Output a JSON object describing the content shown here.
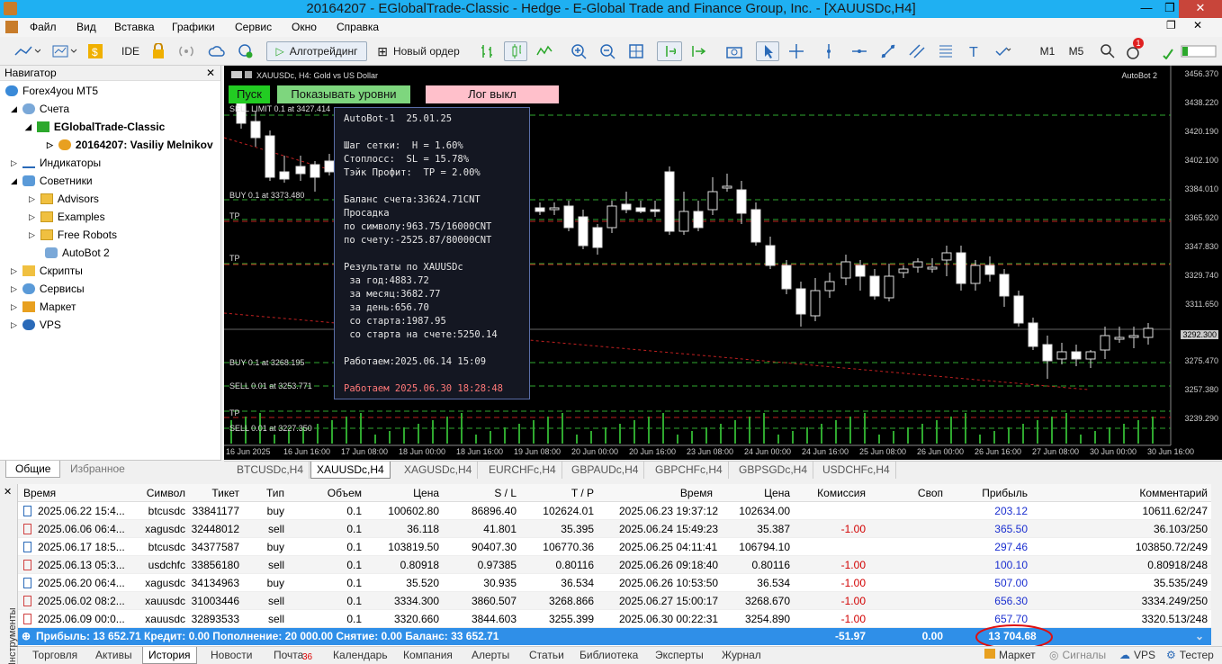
{
  "window": {
    "title": "20164207 - EGlobalTrade-Classic - Hedge - E-Global Trade and Finance Group, Inc. - [XAUUSDc,H4]"
  },
  "menu": [
    "Файл",
    "Вид",
    "Вставка",
    "Графики",
    "Сервис",
    "Окно",
    "Справка"
  ],
  "toolbar": {
    "ide": "IDE",
    "algo": "Алготрейдинг",
    "new_order": "Новый ордер",
    "m1": "M1",
    "m5": "M5",
    "notif_count": "1"
  },
  "navigator": {
    "title": "Навигатор",
    "items": [
      "Forex4you MT5",
      "Счета",
      "EGlobalTrade-Classic",
      "20164207: Vasiliy Melnikov",
      "Индикаторы",
      "Советники",
      "Advisors",
      "Examples",
      "Free Robots",
      "AutoBot 2",
      "Скрипты",
      "Сервисы",
      "Маркет",
      "VPS"
    ],
    "tabs": [
      "Общие",
      "Избранное"
    ]
  },
  "chart": {
    "symbol_label": "XAUUSDc, H4:  Gold vs US Dollar",
    "ea_label": "AutoBot 2",
    "btn_start": "Пуск",
    "btn_levels": "Показывать уровни",
    "btn_log": "Лог выкл",
    "colors": {
      "start": "#22cc22",
      "levels": "#7ed67e",
      "log": "#ffc0cb"
    },
    "order_labels": [
      "SELL LIMIT 0.1 at 3427.414",
      "BUY 0.1 at 3373.480",
      "TP",
      "TP",
      "BUY 0.1 at 3268.195",
      "SELL 0.01 at 3253.771",
      "TP",
      "SELL 0.01 at 3227.350"
    ],
    "current_price": "3292.300",
    "price_ticks": [
      "3456.370",
      "3438.220",
      "3420.190",
      "3402.100",
      "3384.010",
      "3365.920",
      "3347.830",
      "3329.740",
      "3311.650",
      "3292.300",
      "3275.470",
      "3257.380",
      "3239.290"
    ],
    "time_ticks": [
      "16 Jun 2025",
      "16 Jun 16:00",
      "17 Jun 08:00",
      "18 Jun 00:00",
      "18 Jun 16:00",
      "19 Jun 08:00",
      "20 Jun 00:00",
      "20 Jun 16:00",
      "23 Jun 08:00",
      "24 Jun 00:00",
      "24 Jun 16:00",
      "25 Jun 08:00",
      "26 Jun 00:00",
      "26 Jun 16:00",
      "27 Jun 08:00",
      "30 Jun 00:00",
      "30 Jun 16:00"
    ],
    "info": {
      "l1": "AutoBot-1  25.01.25",
      "l2": "Шаг сетки:  H = 1.60%",
      "l3": "Стоплосс:  SL = 15.78%",
      "l4": "Тэйк Профит:  TP = 2.00%",
      "l5": "Баланс счета:33624.71CNT",
      "l6": "Просадка",
      "l7": "по символу:963.75/16000CNT",
      "l8": "по счету:-2525.87/80000CNT",
      "l9": "Результаты по XAUUSDc",
      "l10": " за год:4883.72",
      "l11": " за месяц:3682.77",
      "l12": " за день:656.70",
      "l13": " со старта:1987.95",
      "l14": " со старта на счете:5250.14",
      "l15": "Работаем:2025.06.14 15:09",
      "l16": "Работаем 2025.06.30 18:28:48"
    }
  },
  "chart_tabs": [
    "BTCUSDc,H4",
    "XAUUSDc,H4",
    "XAGUSDc,H4",
    "EURCHFc,H4",
    "GBPAUDc,H4",
    "GBPCHFc,H4",
    "GBPSGDc,H4",
    "USDCHFc,H4"
  ],
  "terminal": {
    "side_label": "Инструменты",
    "headers": [
      "Время",
      "Символ",
      "Тикет",
      "Тип",
      "Объем",
      "Цена",
      "S / L",
      "T / P",
      "Время",
      "Цена",
      "Комиссия",
      "Своп",
      "Прибыль",
      "Комментарий"
    ],
    "rows": [
      [
        "2025.06.22 15:4...",
        "btcusdc",
        "33841177",
        "buy",
        "0.1",
        "100602.80",
        "86896.40",
        "102624.01",
        "2025.06.23 19:37:12",
        "102634.00",
        "",
        "",
        "203.12",
        "10611.62/247"
      ],
      [
        "2025.06.06 06:4...",
        "xagusdc",
        "32448012",
        "sell",
        "0.1",
        "36.118",
        "41.801",
        "35.395",
        "2025.06.24 15:49:23",
        "35.387",
        "-1.00",
        "",
        "365.50",
        "36.103/250"
      ],
      [
        "2025.06.17 18:5...",
        "btcusdc",
        "34377587",
        "buy",
        "0.1",
        "103819.50",
        "90407.30",
        "106770.36",
        "2025.06.25 04:11:41",
        "106794.10",
        "",
        "",
        "297.46",
        "103850.72/249"
      ],
      [
        "2025.06.13 05:3...",
        "usdchfc",
        "33856180",
        "sell",
        "0.1",
        "0.80918",
        "0.97385",
        "0.80116",
        "2025.06.26 09:18:40",
        "0.80116",
        "-1.00",
        "",
        "100.10",
        "0.80918/248"
      ],
      [
        "2025.06.20 06:4...",
        "xagusdc",
        "34134963",
        "buy",
        "0.1",
        "35.520",
        "30.935",
        "36.534",
        "2025.06.26 10:53:50",
        "36.534",
        "-1.00",
        "",
        "507.00",
        "35.535/249"
      ],
      [
        "2025.06.02 08:2...",
        "xauusdc",
        "31003446",
        "sell",
        "0.1",
        "3334.300",
        "3860.507",
        "3268.866",
        "2025.06.27 15:00:17",
        "3268.670",
        "-1.00",
        "",
        "656.30",
        "3334.249/250"
      ],
      [
        "2025.06.09 00:0...",
        "xauusdc",
        "32893533",
        "sell",
        "0.1",
        "3320.660",
        "3844.603",
        "3255.399",
        "2025.06.30 00:22:31",
        "3254.890",
        "-1.00",
        "",
        "657.70",
        "3320.513/248"
      ]
    ],
    "summary": {
      "text": "Прибыль: 13 652.71  Кредит: 0.00  Пополнение: 20 000.00  Снятие: 0.00  Баланс: 33 652.71",
      "commission": "-51.97",
      "swap": "0.00",
      "profit": "13 704.68"
    },
    "tabs": [
      "Торговля",
      "Активы",
      "История",
      "Новости",
      "Почта",
      "Календарь",
      "Компания",
      "Алерты",
      "Статьи",
      "Библиотека",
      "Эксперты",
      "Журнал"
    ],
    "mail_badge": "36",
    "right_tabs": [
      "Маркет",
      "Сигналы",
      "VPS",
      "Тестер"
    ]
  }
}
